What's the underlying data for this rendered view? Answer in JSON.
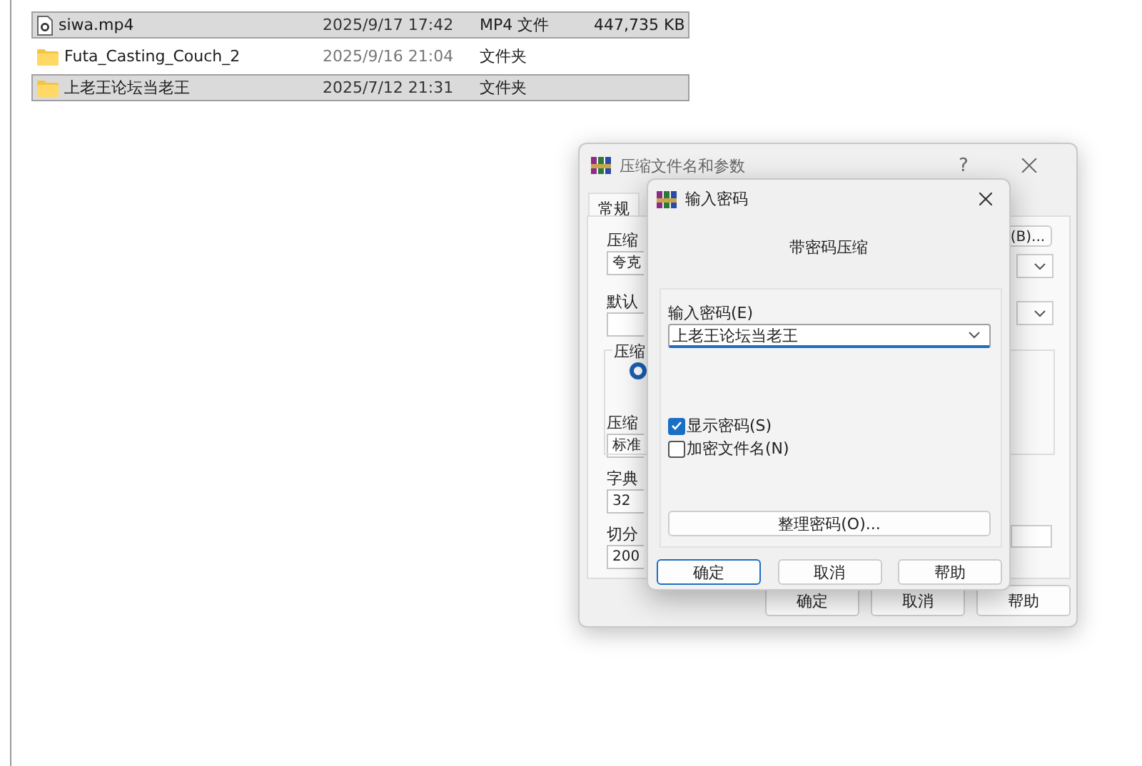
{
  "file_list": {
    "rows": [
      {
        "kind": "video",
        "name": "siwa.mp4",
        "modified": "2025/9/17 17:42",
        "type": "MP4 文件",
        "size": "447,735 KB",
        "selected": true
      },
      {
        "kind": "folder",
        "name": "Futa_Casting_Couch_2",
        "modified": "2025/9/16 21:04",
        "type": "文件夹",
        "selected": false
      },
      {
        "kind": "folder",
        "name": "上老王论坛当老王",
        "modified": "2025/7/12 21:31",
        "type": "文件夹",
        "selected": true
      }
    ]
  },
  "archive_dialog": {
    "title": "压缩文件名和参数",
    "help": "?",
    "tabs": [
      {
        "label": "常规",
        "selected": true
      }
    ],
    "archive_name_label": "压缩",
    "browse_button": "(B)...",
    "archive_name_value": "夸克",
    "profile_label": "默认",
    "format_group_label": "压缩",
    "format_option": {
      "selected": true
    },
    "method_label": "压缩",
    "method_value": "标准",
    "dictionary_label": "字典",
    "dictionary_value": "32",
    "split_label": "切分",
    "split_value": "200",
    "buttons": [
      "确定",
      "取消",
      "帮助"
    ]
  },
  "password_dialog": {
    "title": "输入密码",
    "heading": "带密码压缩",
    "password_label": "输入密码(E)",
    "password_value": "上老王论坛当老王",
    "options": [
      {
        "label": "显示密码(S)",
        "checked": true
      },
      {
        "label": "加密文件名(N)",
        "checked": false
      }
    ],
    "organize_button": "整理密码(O)...",
    "buttons": [
      {
        "label": "确定",
        "default": true
      },
      {
        "label": "取消",
        "default": false
      },
      {
        "label": "帮助",
        "default": false
      }
    ]
  }
}
